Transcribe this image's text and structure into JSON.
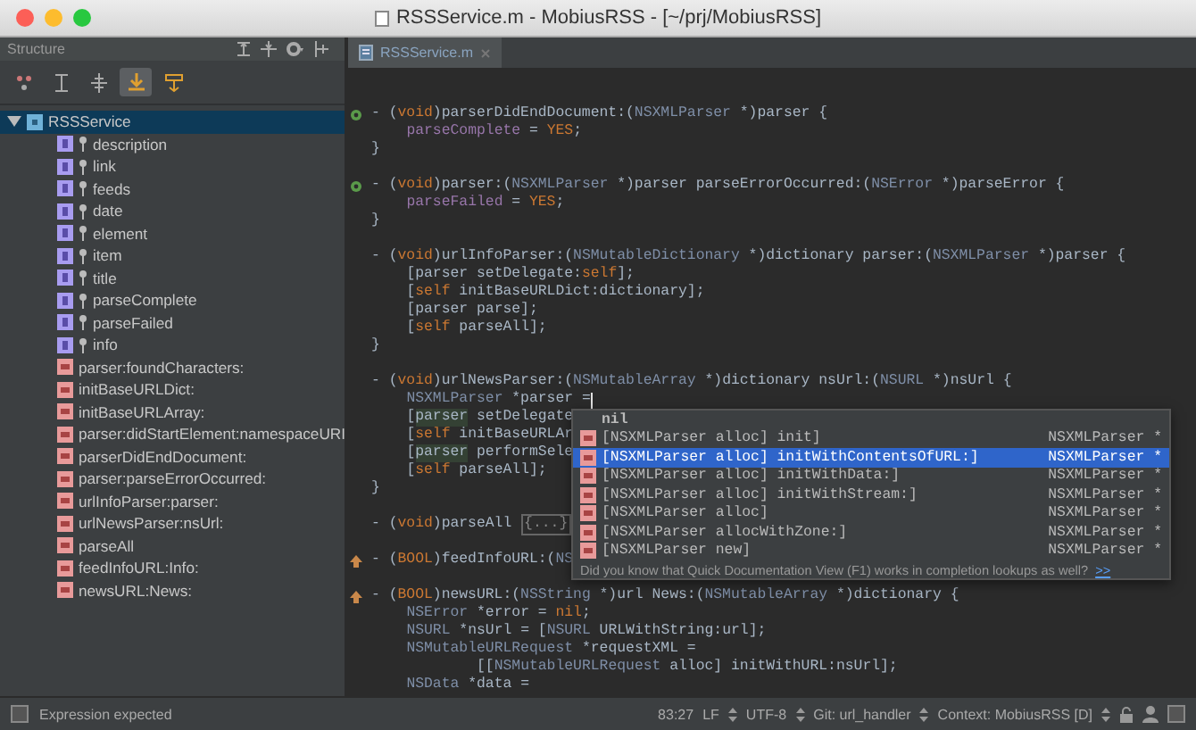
{
  "window": {
    "title": "RSSService.m - MobiusRSS - [~/prj/MobiusRSS]"
  },
  "structure": {
    "title": "Structure",
    "toolbar": [
      {
        "selected": false
      },
      {
        "selected": false
      },
      {
        "selected": false
      },
      {
        "selected": true
      },
      {
        "selected": false
      }
    ],
    "tree": [
      {
        "label": "RSSService",
        "kind": "class",
        "selected": true,
        "expanded": true,
        "children": [
          {
            "label": "description",
            "kind": "field",
            "selected": false
          },
          {
            "label": "link",
            "kind": "field",
            "selected": false
          },
          {
            "label": "feeds",
            "kind": "field",
            "selected": false
          },
          {
            "label": "date",
            "kind": "field",
            "selected": false
          },
          {
            "label": "element",
            "kind": "field",
            "selected": false
          },
          {
            "label": "item",
            "kind": "field",
            "selected": false
          },
          {
            "label": "title",
            "kind": "field",
            "selected": false
          },
          {
            "label": "parseComplete",
            "kind": "field",
            "selected": false
          },
          {
            "label": "parseFailed",
            "kind": "field",
            "selected": false
          },
          {
            "label": "info",
            "kind": "field",
            "selected": false
          },
          {
            "label": "parser:foundCharacters:",
            "kind": "method",
            "selected": false
          },
          {
            "label": "initBaseURLDict:",
            "kind": "method",
            "selected": false
          },
          {
            "label": "initBaseURLArray:",
            "kind": "method",
            "selected": false
          },
          {
            "label": "parser:didStartElement:namespaceURI",
            "kind": "method",
            "selected": false
          },
          {
            "label": "parserDidEndDocument:",
            "kind": "method",
            "selected": false
          },
          {
            "label": "parser:parseErrorOccurred:",
            "kind": "method",
            "selected": false
          },
          {
            "label": "urlInfoParser:parser:",
            "kind": "method",
            "selected": false
          },
          {
            "label": "urlNewsParser:nsUrl:",
            "kind": "method",
            "selected": false
          },
          {
            "label": "parseAll",
            "kind": "method",
            "selected": false
          },
          {
            "label": "feedInfoURL:Info:",
            "kind": "method",
            "selected": false
          },
          {
            "label": "newsURL:News:",
            "kind": "method",
            "selected": false
          }
        ]
      }
    ]
  },
  "editor": {
    "tabs": [
      {
        "label": "RSSService.m",
        "selected": true
      }
    ],
    "methods": [
      {
        "marker": {
          "kind": "override"
        },
        "lines": [
          {
            "tokens": [
              {
                "kind": "plain",
                "text": "- ("
              },
              {
                "kind": "keyword",
                "text": "void"
              },
              {
                "kind": "plain",
                "text": ")parserDidEndDocument:("
              },
              {
                "kind": "type",
                "text": "NSXMLParser"
              },
              {
                "kind": "plain",
                "text": " *)parser {"
              }
            ],
            "children": [
              {
                "tokens": [
                  {
                    "kind": "field",
                    "text": "parseComplete"
                  },
                  {
                    "kind": "plain",
                    "text": " = "
                  },
                  {
                    "kind": "keyword",
                    "text": "YES"
                  },
                  {
                    "kind": "plain",
                    "text": ";"
                  }
                ]
              }
            ]
          },
          {
            "tokens": [
              {
                "kind": "plain",
                "text": "}"
              }
            ]
          }
        ]
      },
      {
        "marker": {
          "kind": "override"
        },
        "lines": [
          {
            "tokens": [
              {
                "kind": "plain",
                "text": "- ("
              },
              {
                "kind": "keyword",
                "text": "void"
              },
              {
                "kind": "plain",
                "text": ")parser:("
              },
              {
                "kind": "type",
                "text": "NSXMLParser"
              },
              {
                "kind": "plain",
                "text": " *)parser parseErrorOccurred:("
              },
              {
                "kind": "type",
                "text": "NSError"
              },
              {
                "kind": "plain",
                "text": " *)parseError {"
              }
            ],
            "children": [
              {
                "tokens": [
                  {
                    "kind": "field",
                    "text": "parseFailed"
                  },
                  {
                    "kind": "plain",
                    "text": " = "
                  },
                  {
                    "kind": "keyword",
                    "text": "YES"
                  },
                  {
                    "kind": "plain",
                    "text": ";"
                  }
                ]
              }
            ]
          },
          {
            "tokens": [
              {
                "kind": "plain",
                "text": "}"
              }
            ]
          }
        ]
      },
      {
        "lines": [
          {
            "tokens": [
              {
                "kind": "plain",
                "text": "- ("
              },
              {
                "kind": "keyword",
                "text": "void"
              },
              {
                "kind": "plain",
                "text": ")urlInfoParser:("
              },
              {
                "kind": "type",
                "text": "NSMutableDictionary"
              },
              {
                "kind": "plain",
                "text": " *)dictionary parser:("
              },
              {
                "kind": "type",
                "text": "NSXMLParser"
              },
              {
                "kind": "plain",
                "text": " *)parser {"
              }
            ],
            "children": [
              {
                "tokens": [
                  {
                    "kind": "plain",
                    "text": "[parser setDelegate:"
                  },
                  {
                    "kind": "keyword",
                    "text": "self"
                  },
                  {
                    "kind": "plain",
                    "text": "];"
                  }
                ]
              },
              {
                "tokens": [
                  {
                    "kind": "plain",
                    "text": "["
                  },
                  {
                    "kind": "keyword",
                    "text": "self"
                  },
                  {
                    "kind": "plain",
                    "text": " initBaseURLDict:dictionary];"
                  }
                ]
              },
              {
                "tokens": [
                  {
                    "kind": "plain",
                    "text": "[parser parse];"
                  }
                ]
              },
              {
                "tokens": [
                  {
                    "kind": "plain",
                    "text": "["
                  },
                  {
                    "kind": "keyword",
                    "text": "self"
                  },
                  {
                    "kind": "plain",
                    "text": " parseAll];"
                  }
                ]
              }
            ]
          },
          {
            "tokens": [
              {
                "kind": "plain",
                "text": "}"
              }
            ]
          }
        ]
      },
      {
        "lines": [
          {
            "tokens": [
              {
                "kind": "plain",
                "text": "- ("
              },
              {
                "kind": "keyword",
                "text": "void"
              },
              {
                "kind": "plain",
                "text": ")urlNewsParser:("
              },
              {
                "kind": "type",
                "text": "NSMutableArray"
              },
              {
                "kind": "plain",
                "text": " *)dictionary nsUrl:("
              },
              {
                "kind": "type",
                "text": "NSURL"
              },
              {
                "kind": "plain",
                "text": " *)nsUrl {"
              }
            ],
            "children": [
              {
                "tokens": [
                  {
                    "kind": "type",
                    "text": "NSXMLParser"
                  },
                  {
                    "kind": "plain",
                    "text": " *parser ="
                  },
                  {
                    "kind": "caret"
                  }
                ]
              },
              {
                "tokens": [
                  {
                    "kind": "plain",
                    "text": "["
                  },
                  {
                    "kind": "usage",
                    "text": "parser"
                  },
                  {
                    "kind": "plain",
                    "text": " setDelegate"
                  }
                ]
              },
              {
                "tokens": [
                  {
                    "kind": "plain",
                    "text": "["
                  },
                  {
                    "kind": "keyword",
                    "text": "self"
                  },
                  {
                    "kind": "plain",
                    "text": " initBaseURLAr"
                  }
                ]
              },
              {
                "tokens": [
                  {
                    "kind": "plain",
                    "text": "["
                  },
                  {
                    "kind": "usage",
                    "text": "parser"
                  },
                  {
                    "kind": "plain",
                    "text": " performSele"
                  }
                ]
              },
              {
                "tokens": [
                  {
                    "kind": "plain",
                    "text": "["
                  },
                  {
                    "kind": "keyword",
                    "text": "self"
                  },
                  {
                    "kind": "plain",
                    "text": " parseAll];"
                  }
                ]
              }
            ]
          },
          {
            "tokens": [
              {
                "kind": "plain",
                "text": "}"
              }
            ]
          }
        ]
      },
      {
        "lines": [
          {
            "tokens": [
              {
                "kind": "plain",
                "text": "- ("
              },
              {
                "kind": "keyword",
                "text": "void"
              },
              {
                "kind": "plain",
                "text": ")parseAll "
              },
              {
                "kind": "fold",
                "text": "{...}"
              }
            ]
          }
        ]
      },
      {
        "marker": {
          "kind": "implements"
        },
        "lines": [
          {
            "tokens": [
              {
                "kind": "plain",
                "text": "- ("
              },
              {
                "kind": "keyword",
                "text": "BOOL"
              },
              {
                "kind": "plain",
                "text": ")feedInfoURL:("
              },
              {
                "kind": "type",
                "text": "NS"
              }
            ]
          }
        ]
      },
      {
        "marker": {
          "kind": "implements"
        },
        "lines": [
          {
            "tokens": [
              {
                "kind": "plain",
                "text": "- ("
              },
              {
                "kind": "keyword",
                "text": "BOOL"
              },
              {
                "kind": "plain",
                "text": ")newsURL:("
              },
              {
                "kind": "type",
                "text": "NSString"
              },
              {
                "kind": "plain",
                "text": " *)url News:("
              },
              {
                "kind": "type",
                "text": "NSMutableArray"
              },
              {
                "kind": "plain",
                "text": " *)dictionary {"
              }
            ],
            "children": [
              {
                "tokens": [
                  {
                    "kind": "type",
                    "text": "NSError"
                  },
                  {
                    "kind": "plain",
                    "text": " *error = "
                  },
                  {
                    "kind": "keyword",
                    "text": "nil"
                  },
                  {
                    "kind": "plain",
                    "text": ";"
                  }
                ]
              },
              {
                "tokens": [
                  {
                    "kind": "type",
                    "text": "NSURL"
                  },
                  {
                    "kind": "plain",
                    "text": " *nsUrl = ["
                  },
                  {
                    "kind": "type",
                    "text": "NSURL"
                  },
                  {
                    "kind": "plain",
                    "text": " URLWithString:url];"
                  }
                ]
              },
              {
                "tokens": [
                  {
                    "kind": "type",
                    "text": "NSMutableURLRequest"
                  },
                  {
                    "kind": "plain",
                    "text": " *requestXML ="
                  }
                ],
                "children": [
                  {
                    "tokens": [
                      {
                        "kind": "plain",
                        "text": "[["
                      },
                      {
                        "kind": "type",
                        "text": "NSMutableURLRequest"
                      },
                      {
                        "kind": "plain",
                        "text": " alloc] initWithURL:nsUrl];"
                      }
                    ]
                  }
                ]
              },
              {
                "tokens": [
                  {
                    "kind": "type",
                    "text": "NSData"
                  },
                  {
                    "kind": "plain",
                    "text": " *data ="
                  }
                ]
              }
            ]
          }
        ]
      }
    ],
    "completion": {
      "items": [
        {
          "kind": "keyword",
          "text": "nil",
          "selected": false
        },
        {
          "kind": "method",
          "text": "[NSXMLParser alloc] init]",
          "type": "NSXMLParser *",
          "selected": false
        },
        {
          "kind": "method",
          "text": "[NSXMLParser alloc] initWithContentsOfURL:]",
          "type": "NSXMLParser *",
          "selected": true
        },
        {
          "kind": "method",
          "text": "[NSXMLParser alloc] initWithData:]",
          "type": "NSXMLParser *",
          "selected": false
        },
        {
          "kind": "method",
          "text": "[NSXMLParser alloc] initWithStream:]",
          "type": "NSXMLParser *",
          "selected": false
        },
        {
          "kind": "method",
          "text": "[NSXMLParser alloc]",
          "type": "NSXMLParser *",
          "selected": false
        },
        {
          "kind": "method",
          "text": "[NSXMLParser allocWithZone:]",
          "type": "NSXMLParser *",
          "selected": false
        },
        {
          "kind": "method",
          "text": "[NSXMLParser new]",
          "type": "NSXMLParser *",
          "selected": false
        }
      ],
      "tip": "Did you know that Quick Documentation View (F1) works in completion lookups as well?",
      "tip_link": ">>"
    }
  },
  "status_bar": {
    "message": "Expression expected",
    "position": "83:27",
    "items": [
      "LF",
      "UTF-8",
      "Git: url_handler",
      "Context: MobiusRSS [D]"
    ]
  }
}
